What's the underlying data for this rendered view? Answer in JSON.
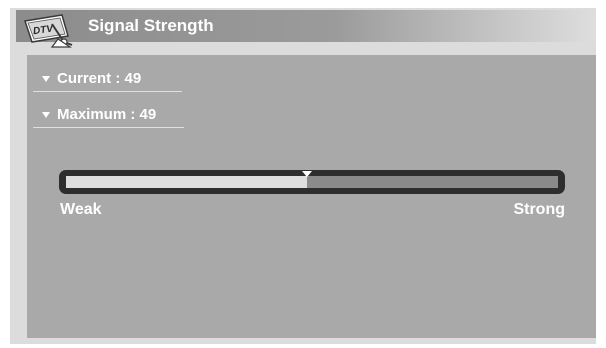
{
  "header": {
    "title": "Signal Strength",
    "logo_icon": "dtv-satellite-logo-icon"
  },
  "signal": {
    "current_text": "Current : 49",
    "maximum_text": "Maximum : 49",
    "current_value": 49,
    "maximum_value": 49,
    "scale_min": 0,
    "scale_max": 100
  },
  "scale": {
    "weak_label": "Weak",
    "strong_label": "Strong"
  },
  "colors": {
    "panel": "#a9a9a9",
    "header": "#8c8c8c",
    "bar_fill": "#dedede",
    "bar_empty": "#8a8a8a",
    "bar_border": "#2e2e2e"
  }
}
